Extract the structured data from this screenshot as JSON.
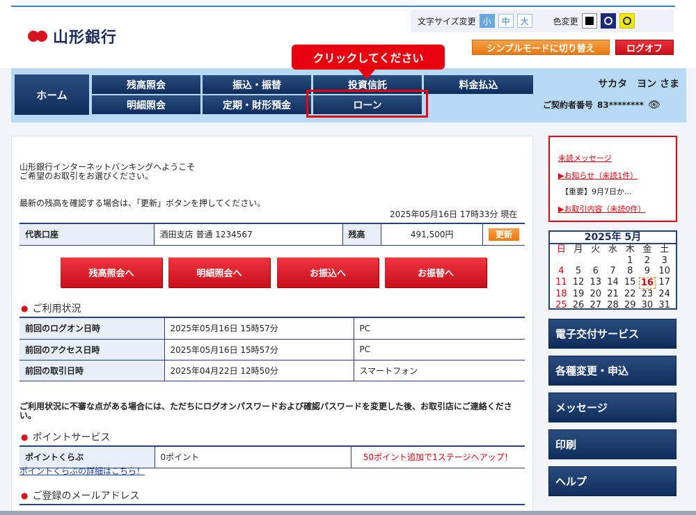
{
  "header": {
    "logo_text": "山形銀行",
    "font_size_label": "文字サイズ変更",
    "font_sizes": [
      "小",
      "中",
      "大"
    ],
    "color_label": "色変更",
    "simple_mode_button": "シンプルモードに切り替え",
    "logoff_button": "ログオフ"
  },
  "callout": {
    "text": "クリックしてください"
  },
  "nav": {
    "home": "ホーム",
    "row1": [
      "残高照会",
      "振込・振替",
      "投資信託",
      "料金払込"
    ],
    "row2": [
      "明細照会",
      "定期・財形預金",
      "ローン"
    ]
  },
  "user": {
    "name": "サカタ　ヨン さま",
    "contract_label": "ご契約者番号",
    "contract_number": "83********"
  },
  "welcome": {
    "line1": "山形銀行インターネットバンキングへようこそ",
    "line2": "ご希望のお取引をお選びください。",
    "refresh_note": "最新の残高を確認する場合は、「更新」ボタンを押してください。",
    "timestamp": "2025年05月16日 17時33分 現在"
  },
  "account": {
    "label": "代表口座",
    "branch": "酒田支店 普通 1234567",
    "balance_label": "残高",
    "balance": "491,500円",
    "update_button": "更新"
  },
  "action_buttons": [
    "残高照会へ",
    "明細照会へ",
    "お振込へ",
    "お振替へ"
  ],
  "usage": {
    "heading": "ご利用状況",
    "rows": [
      {
        "label": "前回のログオン日時",
        "datetime": "2025年05月16日 15時57分",
        "device": "PC"
      },
      {
        "label": "前回のアクセス日時",
        "datetime": "2025年05月16日 15時57分",
        "device": "PC"
      },
      {
        "label": "前回の取引日時",
        "datetime": "2025年04月22日 12時50分",
        "device": "スマートフォン"
      }
    ],
    "warning": "ご利用状況に不審な点がある場合には、ただちにログオンパスワードおよび確認パスワードを変更した後、お取引店にご連絡ください。"
  },
  "points": {
    "heading": "ポイントサービス",
    "label": "ポイントくらぶ",
    "value": "0ポイント",
    "promo": "50ポイント追加で1ステージへアップ！",
    "detail_link": "ポイントくらぶの詳細はこちら！"
  },
  "email": {
    "heading": "ご登録のメールアドレス"
  },
  "messages": {
    "unread_link": "未読メッセージ",
    "notice_link": "▶お知らせ（未読1件）",
    "notice_item": "【重要】9月7日か...",
    "transaction_link": "▶お取引内容（未読0件）"
  },
  "calendar": {
    "title": "2025年 5月",
    "weekdays": [
      "日",
      "月",
      "火",
      "水",
      "木",
      "金",
      "土"
    ],
    "days": [
      "",
      "",
      "",
      "",
      "1",
      "2",
      "3",
      "4",
      "5",
      "6",
      "7",
      "8",
      "9",
      "10",
      "11",
      "12",
      "13",
      "14",
      "15",
      "16",
      "17",
      "18",
      "19",
      "20",
      "21",
      "22",
      "23",
      "24",
      "25",
      "26",
      "27",
      "28",
      "29",
      "30",
      "31"
    ],
    "today": "16"
  },
  "side_buttons": [
    "電子交付サービス",
    "各種変更・申込",
    "メッセージ",
    "印刷",
    "ヘルプ"
  ],
  "colors": {
    "navy": "#0f2e5c",
    "red": "#d6161f",
    "orange": "#e87a12",
    "accent_blue": "#3a7fc4"
  }
}
